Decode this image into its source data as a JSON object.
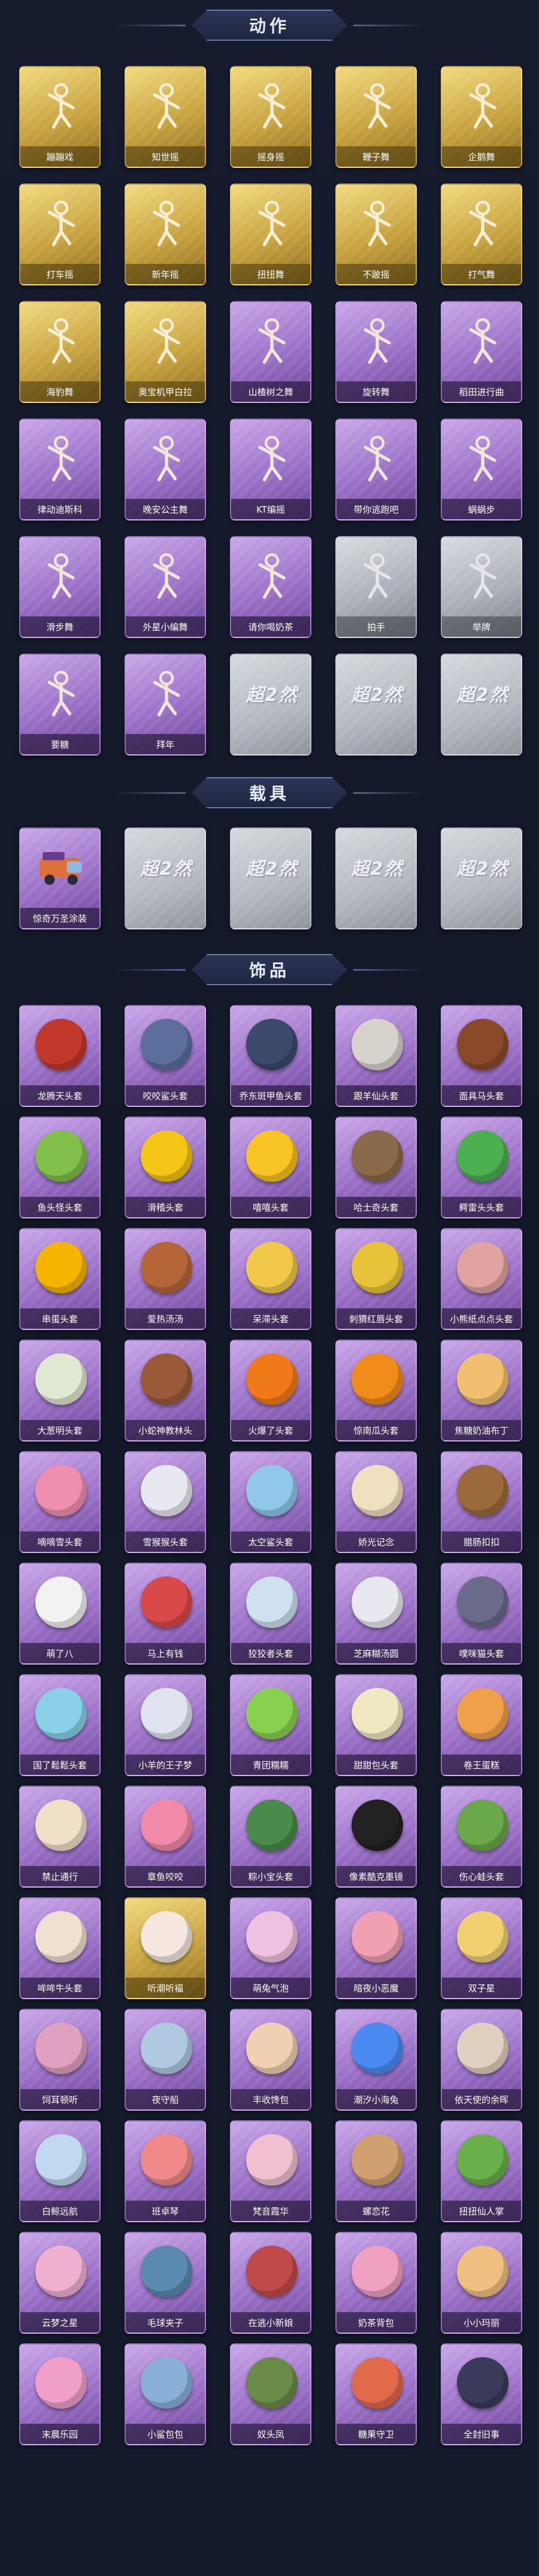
{
  "sections": [
    {
      "title": "动作"
    },
    {
      "title": "载具"
    },
    {
      "title": "饰品"
    }
  ],
  "actions": [
    {
      "label": "蹦蹦戏",
      "rarity": "gold"
    },
    {
      "label": "知世摇",
      "rarity": "gold"
    },
    {
      "label": "摇身摇",
      "rarity": "gold"
    },
    {
      "label": "鞭子舞",
      "rarity": "gold"
    },
    {
      "label": "企鹅舞",
      "rarity": "gold"
    },
    {
      "label": "打车摇",
      "rarity": "gold"
    },
    {
      "label": "新年摇",
      "rarity": "gold"
    },
    {
      "label": "扭扭舞",
      "rarity": "gold"
    },
    {
      "label": "不跛摇",
      "rarity": "gold"
    },
    {
      "label": "打气舞",
      "rarity": "gold"
    },
    {
      "label": "海豹舞",
      "rarity": "gold"
    },
    {
      "label": "奥宝机甲白拉",
      "rarity": "gold"
    },
    {
      "label": "山楂树之舞",
      "rarity": "purple"
    },
    {
      "label": "旋转舞",
      "rarity": "purple"
    },
    {
      "label": "稻田进行曲",
      "rarity": "purple"
    },
    {
      "label": "律动迪斯科",
      "rarity": "purple"
    },
    {
      "label": "晚安公主舞",
      "rarity": "purple"
    },
    {
      "label": "KT编摇",
      "rarity": "purple"
    },
    {
      "label": "带你逃跑吧",
      "rarity": "purple"
    },
    {
      "label": "蜗蜗步",
      "rarity": "purple"
    },
    {
      "label": "滑步舞",
      "rarity": "purple"
    },
    {
      "label": "外星小编舞",
      "rarity": "purple"
    },
    {
      "label": "请你喝奶茶",
      "rarity": "purple"
    },
    {
      "label": "拍手",
      "rarity": "silver"
    },
    {
      "label": "举牌",
      "rarity": "silver"
    },
    {
      "label": "要糖",
      "rarity": "purple"
    },
    {
      "label": "拜年",
      "rarity": "purple"
    },
    {
      "label": "",
      "rarity": "empty",
      "logo": "超2然"
    },
    {
      "label": "",
      "rarity": "empty",
      "logo": "超2然"
    },
    {
      "label": "",
      "rarity": "empty",
      "logo": "超2然"
    }
  ],
  "vehicles": [
    {
      "label": "惊奇万圣涂装",
      "rarity": "purple"
    },
    {
      "label": "",
      "rarity": "empty",
      "logo": "超2然"
    },
    {
      "label": "",
      "rarity": "empty",
      "logo": "超2然"
    },
    {
      "label": "",
      "rarity": "empty",
      "logo": "超2然"
    },
    {
      "label": "",
      "rarity": "empty",
      "logo": "超2然"
    }
  ],
  "accessories": [
    {
      "label": "龙腾天头套",
      "rarity": "purple",
      "color": "#c0392b"
    },
    {
      "label": "咬咬鲨头套",
      "rarity": "purple",
      "color": "#5b6e9c"
    },
    {
      "label": "乔东斑甲鱼头套",
      "rarity": "purple",
      "color": "#3b4a6b"
    },
    {
      "label": "跟羊仙头套",
      "rarity": "purple",
      "color": "#d8d2cc"
    },
    {
      "label": "面具马头套",
      "rarity": "purple",
      "color": "#8a4a2a"
    },
    {
      "label": "鱼头怪头套",
      "rarity": "purple",
      "color": "#7fbf4a"
    },
    {
      "label": "滑稽头套",
      "rarity": "purple",
      "color": "#f5c518"
    },
    {
      "label": "嘻嘻头套",
      "rarity": "purple",
      "color": "#f7c325"
    },
    {
      "label": "哈士奇头套",
      "rarity": "purple",
      "color": "#8a6a4a"
    },
    {
      "label": "鳄雷头头套",
      "rarity": "purple",
      "color": "#4caf50"
    },
    {
      "label": "串蛋头套",
      "rarity": "purple",
      "color": "#f4b400"
    },
    {
      "label": "爱热汤汤",
      "rarity": "purple",
      "color": "#b5653a"
    },
    {
      "label": "呆滞头套",
      "rarity": "purple",
      "color": "#f2c84b"
    },
    {
      "label": "刺猬红唇头套",
      "rarity": "purple",
      "color": "#e8c33a"
    },
    {
      "label": "小熊纸点点头套",
      "rarity": "purple",
      "color": "#e0a3a0"
    },
    {
      "label": "大葱明头套",
      "rarity": "purple",
      "color": "#dfe8d0"
    },
    {
      "label": "小蛇神教林头",
      "rarity": "purple",
      "color": "#9a5a3a"
    },
    {
      "label": "火爆了头套",
      "rarity": "purple",
      "color": "#f07a1a"
    },
    {
      "label": "惊南瓜头套",
      "rarity": "purple",
      "color": "#f08c1a"
    },
    {
      "label": "焦糖奶油布丁",
      "rarity": "purple",
      "color": "#f0c070"
    },
    {
      "label": "嘀嘀雪头套",
      "rarity": "purple",
      "color": "#ef8fb0"
    },
    {
      "label": "雪猴猴头套",
      "rarity": "purple",
      "color": "#e8e8f0"
    },
    {
      "label": "太空鲨头套",
      "rarity": "purple",
      "color": "#8fc8e8"
    },
    {
      "label": "娇光记念",
      "rarity": "purple",
      "color": "#f0e0c0"
    },
    {
      "label": "腊肠扣扣",
      "rarity": "purple",
      "color": "#9a6a3a"
    },
    {
      "label": "萌了八",
      "rarity": "purple",
      "color": "#f2f2f2"
    },
    {
      "label": "马上有钱",
      "rarity": "purple",
      "color": "#d84a4a"
    },
    {
      "label": "狡狡者头套",
      "rarity": "purple",
      "color": "#cfe0f0"
    },
    {
      "label": "芝麻糊汤圆",
      "rarity": "purple",
      "color": "#e8e8f0"
    },
    {
      "label": "噗咪猫头套",
      "rarity": "purple",
      "color": "#6a6a8a"
    },
    {
      "label": "国了鬆鬆头套",
      "rarity": "purple",
      "color": "#8ad0e8"
    },
    {
      "label": "小羊的王子梦",
      "rarity": "purple",
      "color": "#dfe4f0"
    },
    {
      "label": "青团糯糯",
      "rarity": "purple",
      "color": "#8ad050"
    },
    {
      "label": "甜甜包头套",
      "rarity": "purple",
      "color": "#f0e8c0"
    },
    {
      "label": "卷王蛋糕",
      "rarity": "purple",
      "color": "#f0a04a"
    },
    {
      "label": "禁止通行",
      "rarity": "purple",
      "color": "#f0e0c8"
    },
    {
      "label": "章鱼咬咬",
      "rarity": "purple",
      "color": "#f08aa8"
    },
    {
      "label": "粽小宝头套",
      "rarity": "purple",
      "color": "#4a8a4a"
    },
    {
      "label": "像素酷克墨镜",
      "rarity": "purple",
      "color": "#222222"
    },
    {
      "label": "伤心蛙头套",
      "rarity": "purple",
      "color": "#6aa84a"
    },
    {
      "label": "哞哞牛头套",
      "rarity": "purple",
      "color": "#f0e0d0"
    },
    {
      "label": "听潮听福",
      "rarity": "gold",
      "color": "#f6e7e0"
    },
    {
      "label": "萌兔气泡",
      "rarity": "purple",
      "color": "#f0c0e0"
    },
    {
      "label": "暗夜小恶魔",
      "rarity": "purple",
      "color": "#f0a0b0"
    },
    {
      "label": "双子星",
      "rarity": "purple",
      "color": "#f0d070"
    },
    {
      "label": "饲耳顿听",
      "rarity": "purple",
      "color": "#e0a0c0"
    },
    {
      "label": "夜守船",
      "rarity": "purple",
      "color": "#b0c8e0"
    },
    {
      "label": "丰收馋包",
      "rarity": "purple",
      "color": "#f0d0b0"
    },
    {
      "label": "潮汐小海兔",
      "rarity": "purple",
      "color": "#4a8af0"
    },
    {
      "label": "依天使的余晖",
      "rarity": "purple",
      "color": "#e0d0c0"
    },
    {
      "label": "白鲸远航",
      "rarity": "purple",
      "color": "#c0d8f0"
    },
    {
      "label": "班卓琴",
      "rarity": "purple",
      "color": "#f08a8a"
    },
    {
      "label": "梵音霞华",
      "rarity": "purple",
      "color": "#f0c0d0"
    },
    {
      "label": "螺恋花",
      "rarity": "purple",
      "color": "#d0a070"
    },
    {
      "label": "扭扭仙人掌",
      "rarity": "purple",
      "color": "#6ab04a"
    },
    {
      "label": "云梦之星",
      "rarity": "purple",
      "color": "#f0b0d0"
    },
    {
      "label": "毛球夹子",
      "rarity": "purple",
      "color": "#5a8ab0"
    },
    {
      "label": "在逃小新娘",
      "rarity": "purple",
      "color": "#c04a4a"
    },
    {
      "label": "奶茶背包",
      "rarity": "purple",
      "color": "#f0a0c0"
    },
    {
      "label": "小小玛丽",
      "rarity": "purple",
      "color": "#f0c080"
    },
    {
      "label": "末晨乐园",
      "rarity": "purple",
      "color": "#f0a0c8"
    },
    {
      "label": "小鲨包包",
      "rarity": "purple",
      "color": "#8ab0d8"
    },
    {
      "label": "奴头凤",
      "rarity": "purple",
      "color": "#6a8a4a"
    },
    {
      "label": "糖果守卫",
      "rarity": "purple",
      "color": "#e06a4a"
    },
    {
      "label": "全封旧事",
      "rarity": "purple",
      "color": "#3a3a5a"
    }
  ]
}
